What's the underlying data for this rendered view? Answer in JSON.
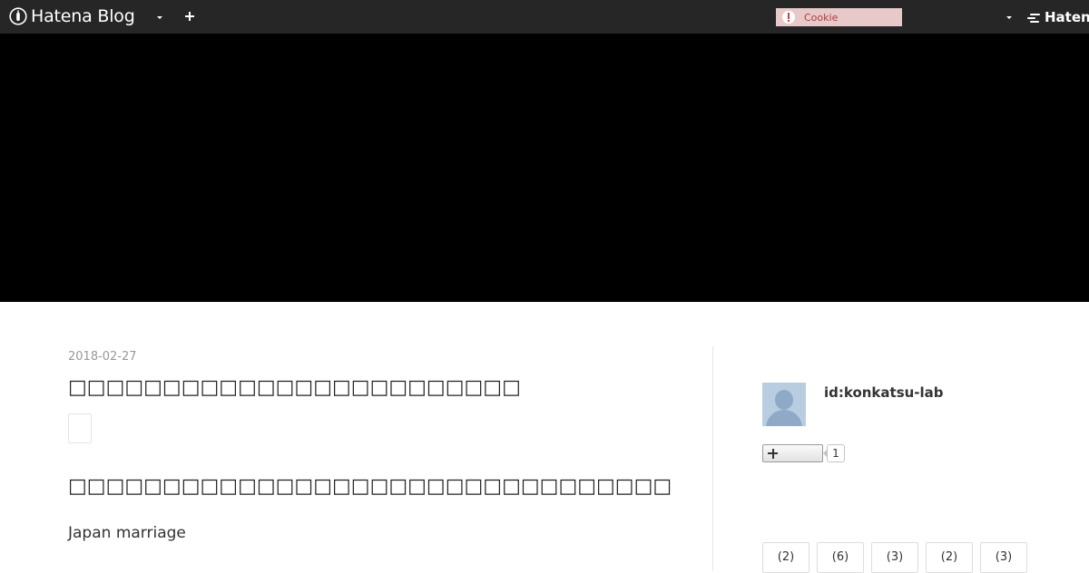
{
  "header": {
    "brand": "Hatena Blog",
    "cookie_notice": "Cookie",
    "hatena_link": "Hatena"
  },
  "entry": {
    "date": "2018-02-27",
    "title": "□□□□□□□□□□□□□□□□□□□□□□□□",
    "heading": "□□□□□□□□□□□□□□□□□□□□□□□□□□□□□□□□",
    "body": "Japan marriage"
  },
  "sidebar": {
    "profile_id": "id:konkatsu-lab",
    "follower_count": "1",
    "categories": [
      {
        "count": "(2)"
      },
      {
        "count": "(6)"
      },
      {
        "count": "(3)"
      },
      {
        "count": "(2)"
      },
      {
        "count": "(3)"
      }
    ]
  },
  "colors": {
    "header_bg": "#262626",
    "banner_bg": "#000000",
    "cookie_bg": "#e8c9c9",
    "avatar_bg": "#b9cde0"
  }
}
